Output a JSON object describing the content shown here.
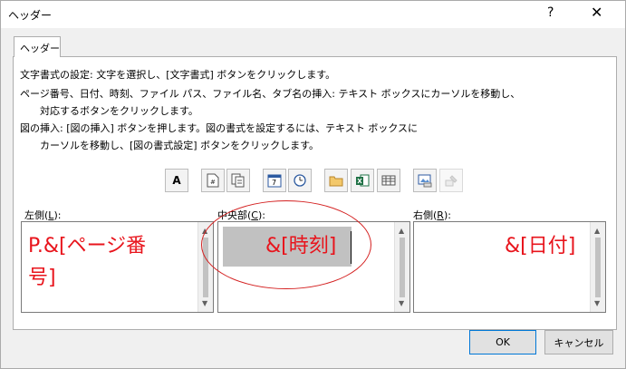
{
  "window": {
    "title": "ヘッダー",
    "help": "?",
    "close": "✕"
  },
  "tab": {
    "label": "ヘッダー"
  },
  "instructions": [
    "文字書式の設定: 文字を選択し、[文字書式] ボタンをクリックします。",
    "ページ番号、日付、時刻、ファイル パス、ファイル名、タブ名の挿入: テキスト ボックスにカーソルを移動し、",
    "　　対応するボタンをクリックします。",
    "図の挿入: [図の挿入] ボタンを押します。図の書式を設定するには、テキスト ボックスに",
    "　　カーソルを移動し、[図の書式設定] ボタンをクリックします。"
  ],
  "toolbar": {
    "format_text": "A",
    "page_number_icon": "#",
    "date_icon": "7"
  },
  "sections": {
    "left": {
      "label": "左側(",
      "key": "L",
      "suffix": "):",
      "text_line1": "P.&[ページ番",
      "text_line2": "号]"
    },
    "center": {
      "label": "中央部(",
      "key": "C",
      "suffix": "):",
      "text": "&[時刻]"
    },
    "right": {
      "label": "右側(",
      "key": "R",
      "suffix": "):",
      "text": "&[日付]"
    }
  },
  "buttons": {
    "ok": "OK",
    "cancel": "キャンセル"
  },
  "colors": {
    "field_text": "#e8141c",
    "annotation": "#d42020"
  }
}
